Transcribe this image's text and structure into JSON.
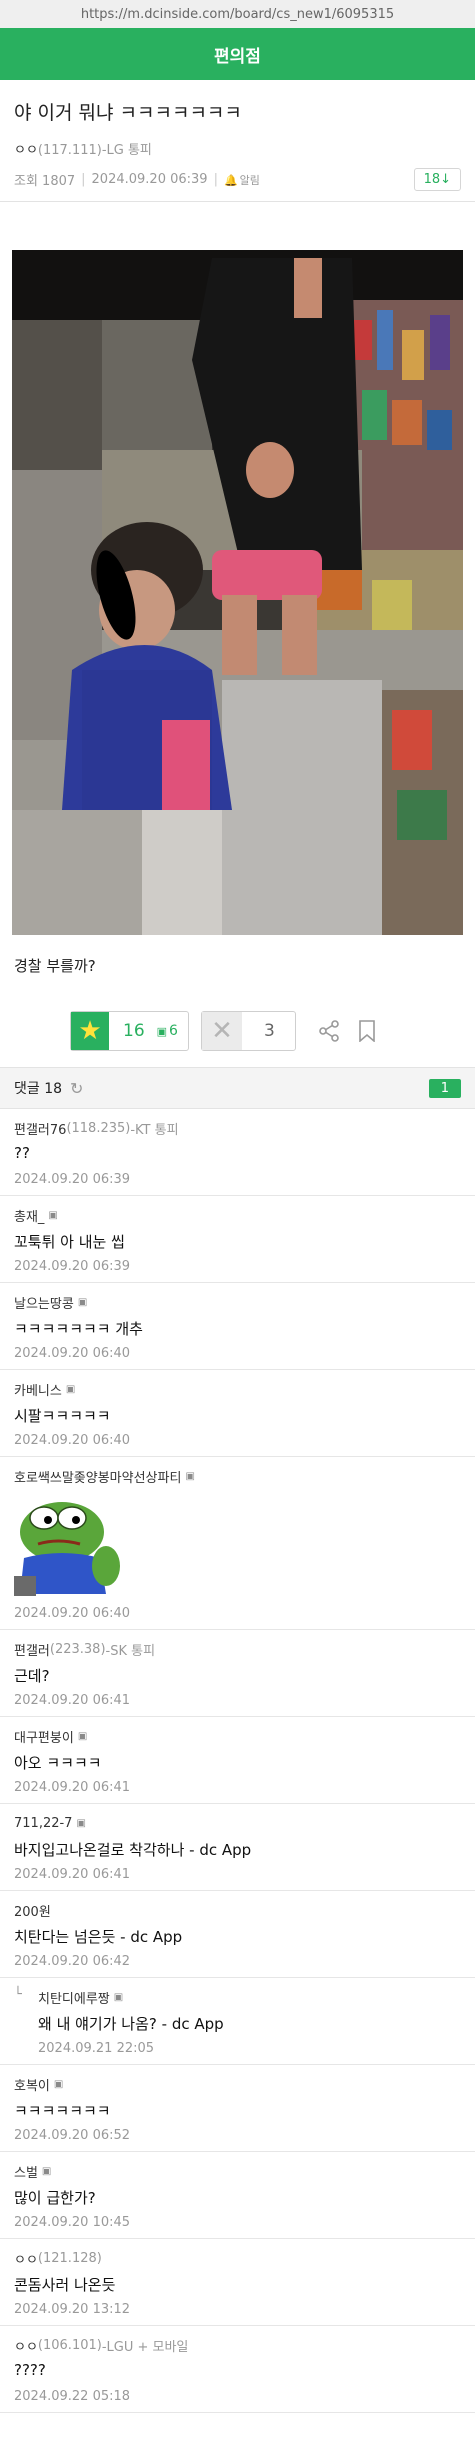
{
  "browser": {
    "url": "https://m.dcinside.com/board/cs_new1/6095315"
  },
  "header": {
    "gallery_name": "편의점"
  },
  "post": {
    "title": "야 이거 뭐냐 ㅋㅋㅋㅋㅋㅋㅋ",
    "author_name": "ㅇㅇ",
    "author_ip": "(117.111)",
    "author_carrier": "-LG 통피",
    "views_label": "조회 1807",
    "date": "2024.09.20 06:39",
    "alarm_label": "알림",
    "reply_count_badge": "18↓",
    "body_text": "경찰 부를까?",
    "recommend_count": "16",
    "fixed_recommend_count": "6",
    "nonrecommend_count": "3"
  },
  "comments_header": {
    "label": "댓글 18",
    "page": "1"
  },
  "comments": [
    {
      "author": "편갤러76",
      "ip": "(118.235)",
      "carrier": "-KT 통피",
      "fix": false,
      "body": "??",
      "date": "2024.09.20 06:39"
    },
    {
      "author": "총재_",
      "ip": "",
      "carrier": "",
      "fix": true,
      "body": "꼬툭튀 아 내눈 씹",
      "date": "2024.09.20 06:39"
    },
    {
      "author": "날으는땅콩",
      "ip": "",
      "carrier": "",
      "fix": true,
      "body": "ㅋㅋㅋㅋㅋㅋㅋ 개추",
      "date": "2024.09.20 06:40"
    },
    {
      "author": "카베니스",
      "ip": "",
      "carrier": "",
      "fix": true,
      "body": "시팔ㅋㅋㅋㅋㅋ",
      "date": "2024.09.20 06:40"
    },
    {
      "author": "호로쌕쓰말좆양봉마약선상파티",
      "ip": "",
      "carrier": "",
      "fix": true,
      "body": "",
      "date": "2024.09.20 06:40",
      "image": "pepe-sticker"
    },
    {
      "author": "편갤러",
      "ip": "(223.38)",
      "carrier": "-SK 통피",
      "fix": false,
      "body": "근데?",
      "date": "2024.09.20 06:41"
    },
    {
      "author": "대구편붕이",
      "ip": "",
      "carrier": "",
      "fix": true,
      "body": "아오 ㅋㅋㅋㅋ",
      "date": "2024.09.20 06:41"
    },
    {
      "author": "711,22-7",
      "ip": "",
      "carrier": "",
      "fix": true,
      "body": "바지입고나온걸로 착각하나 - dc App",
      "date": "2024.09.20 06:41"
    },
    {
      "author": "200원",
      "ip": "",
      "carrier": "",
      "fix": true,
      "body": "치탄다는 넘은듯 - dc App",
      "date": "2024.09.20 06:42"
    },
    {
      "author": "치탄디에루짱",
      "ip": "",
      "carrier": "",
      "fix": true,
      "body": "왜 내 얘기가 나옴? - dc App",
      "date": "2024.09.21 22:05",
      "reply": true
    },
    {
      "author": "호복이",
      "ip": "",
      "carrier": "",
      "fix": true,
      "body": "ㅋㅋㅋㅋㅋㅋㅋ",
      "date": "2024.09.20 06:52"
    },
    {
      "author": "스벌",
      "ip": "",
      "carrier": "",
      "fix": true,
      "body": "많이 급한가?",
      "date": "2024.09.20 10:45"
    },
    {
      "author": "ㅇㅇ",
      "ip": "(121.128)",
      "carrier": "",
      "fix": false,
      "body": "콘돔사러 나온듯",
      "date": "2024.09.20 13:12"
    },
    {
      "author": "ㅇㅇ",
      "ip": "(106.101)",
      "carrier": "-LGU + 모바일",
      "fix": false,
      "body": "????",
      "date": "2024.09.22 05:18"
    }
  ],
  "colors": {
    "accent": "#29b05f",
    "star": "#ffe23b"
  }
}
